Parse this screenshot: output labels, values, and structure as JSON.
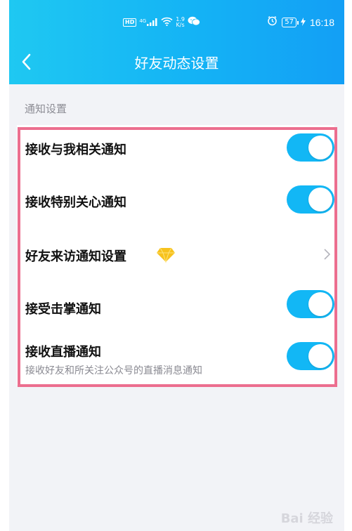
{
  "status_bar": {
    "hd_label": "HD",
    "network_type": "4G",
    "speed_value": "1.9",
    "speed_unit": "K/s",
    "battery_level": "57",
    "time": "16:18"
  },
  "navbar": {
    "back_icon": "chevron-left-icon",
    "title": "好友动态设置"
  },
  "section": {
    "title": "通知设置"
  },
  "settings": [
    {
      "label": "接收与我相关通知",
      "control": "toggle",
      "on": true
    },
    {
      "label": "接收特别关心通知",
      "control": "toggle",
      "on": true
    },
    {
      "label": "好友来访通知设置",
      "control": "chevron",
      "badge_icon": "diamond-icon"
    },
    {
      "label": "接受击掌通知",
      "control": "toggle",
      "on": true
    },
    {
      "label": "接收直播通知",
      "subtitle": "接收好友和所关注公众号的直播消息通知",
      "control": "toggle",
      "on": true
    }
  ],
  "watermark": "Bai 经验",
  "colors": {
    "header_gradient_start": "#1fc8f2",
    "header_gradient_end": "#139ff5",
    "toggle_on": "#12b7f5",
    "highlight_border": "#ec6e8f",
    "page_background": "#f2f3f7"
  }
}
